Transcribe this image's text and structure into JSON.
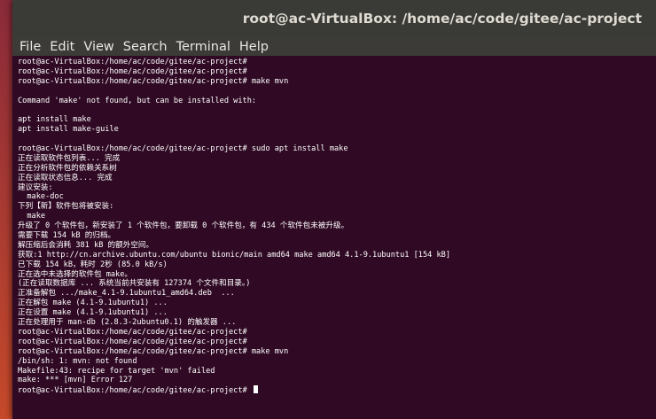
{
  "window": {
    "title": "root@ac-VirtualBox: /home/ac/code/gitee/ac-project"
  },
  "menu": [
    "File",
    "Edit",
    "View",
    "Search",
    "Terminal",
    "Help"
  ],
  "terminal": {
    "lines": [
      "root@ac-VirtualBox:/home/ac/code/gitee/ac-project#",
      "root@ac-VirtualBox:/home/ac/code/gitee/ac-project#",
      "root@ac-VirtualBox:/home/ac/code/gitee/ac-project# make mvn",
      "",
      "Command 'make' not found, but can be installed with:",
      "",
      "apt install make",
      "apt install make-guile",
      "",
      "root@ac-VirtualBox:/home/ac/code/gitee/ac-project# sudo apt install make",
      "正在读取软件包列表... 完成",
      "正在分析软件包的依赖关系树",
      "正在读取状态信息... 完成",
      "建议安装:",
      "  make-doc",
      "下列【新】软件包将被安装:",
      "  make",
      "升级了 0 个软件包，新安装了 1 个软件包，要卸载 0 个软件包，有 434 个软件包未被升级。",
      "需要下载 154 kB 的归档。",
      "解压缩后会消耗 381 kB 的额外空间。",
      "获取:1 http://cn.archive.ubuntu.com/ubuntu bionic/main amd64 make amd64 4.1-9.1ubuntu1 [154 kB]",
      "已下载 154 kB，耗时 2秒 (85.0 kB/s)",
      "正在选中未选择的软件包 make。",
      "(正在读取数据库 ... 系统当前共安装有 127374 个文件和目录。)",
      "正准备解包 .../make_4.1-9.1ubuntu1_amd64.deb  ...",
      "正在解包 make (4.1-9.1ubuntu1) ...",
      "正在设置 make (4.1-9.1ubuntu1) ...",
      "正在处理用于 man-db (2.8.3-2ubuntu0.1) 的触发器 ...",
      "root@ac-VirtualBox:/home/ac/code/gitee/ac-project#",
      "root@ac-VirtualBox:/home/ac/code/gitee/ac-project#",
      "root@ac-VirtualBox:/home/ac/code/gitee/ac-project# make mvn",
      "/bin/sh: 1: mvn: not found",
      "Makefile:43: recipe for target 'mvn' failed",
      "make: *** [mvn] Error 127",
      "root@ac-VirtualBox:/home/ac/code/gitee/ac-project# "
    ]
  }
}
